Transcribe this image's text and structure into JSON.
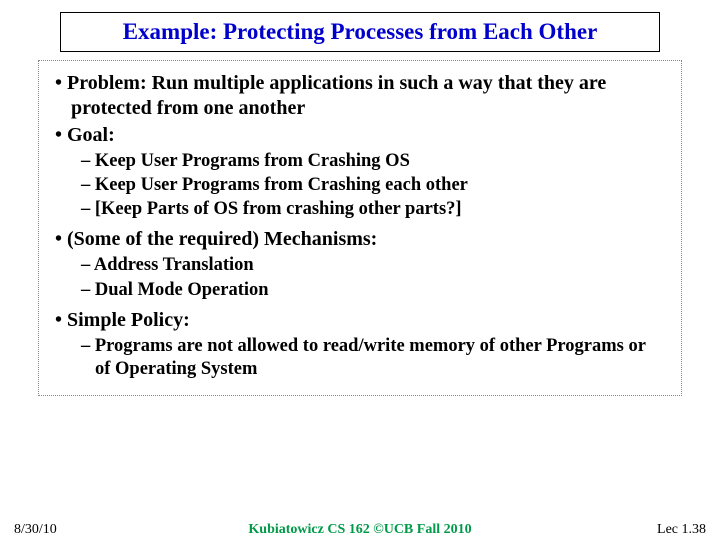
{
  "title": "Example: Protecting Processes from Each Other",
  "bullets": {
    "problem": "• Problem: Run multiple applications in such a way that they are protected from one another",
    "goal": "• Goal:",
    "goal_sub": [
      "– Keep User Programs from Crashing OS",
      "– Keep User Programs from Crashing each other",
      "– [Keep Parts of OS from crashing other parts?]"
    ],
    "mechanisms": "• (Some of the required) Mechanisms:",
    "mechanisms_sub": [
      "– Address Translation",
      "– Dual Mode Operation"
    ],
    "policy": "• Simple Policy:",
    "policy_sub": [
      "– Programs are not allowed to read/write memory of other Programs or of Operating System"
    ]
  },
  "footer": {
    "date": "8/30/10",
    "center": "Kubiatowicz CS 162 ©UCB Fall 2010",
    "page": "Lec 1.38"
  }
}
